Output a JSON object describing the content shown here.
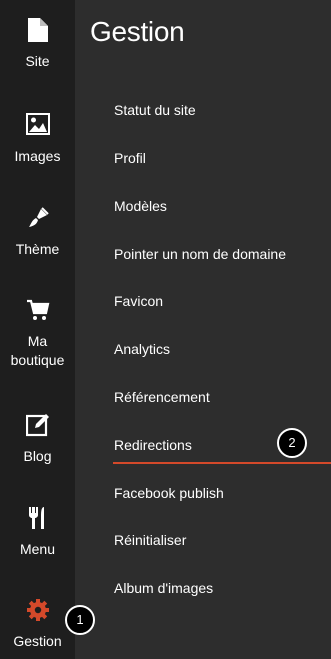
{
  "sidebar": {
    "items": [
      {
        "label": "Site",
        "icon": "file-icon"
      },
      {
        "label": "Images",
        "icon": "image-icon"
      },
      {
        "label": "Thème",
        "icon": "brush-icon"
      },
      {
        "label": "Ma boutique",
        "icon": "cart-icon"
      },
      {
        "label": "Blog",
        "icon": "edit-icon"
      },
      {
        "label": "Menu",
        "icon": "utensils-icon"
      },
      {
        "label": "Gestion",
        "icon": "gear-icon"
      }
    ]
  },
  "main": {
    "title": "Gestion",
    "items": [
      {
        "label": "Statut du site"
      },
      {
        "label": "Profil"
      },
      {
        "label": "Modèles"
      },
      {
        "label": "Pointer un nom de domaine"
      },
      {
        "label": "Favicon"
      },
      {
        "label": "Analytics"
      },
      {
        "label": "Référencement"
      },
      {
        "label": "Redirections"
      },
      {
        "label": "Facebook publish"
      },
      {
        "label": "Réinitialiser"
      },
      {
        "label": "Album d'images"
      }
    ]
  },
  "callouts": [
    "1",
    "2"
  ],
  "colors": {
    "accent": "#d4492a",
    "sidebar_bg": "#1e1e1e",
    "main_bg": "#2d2d2d"
  }
}
